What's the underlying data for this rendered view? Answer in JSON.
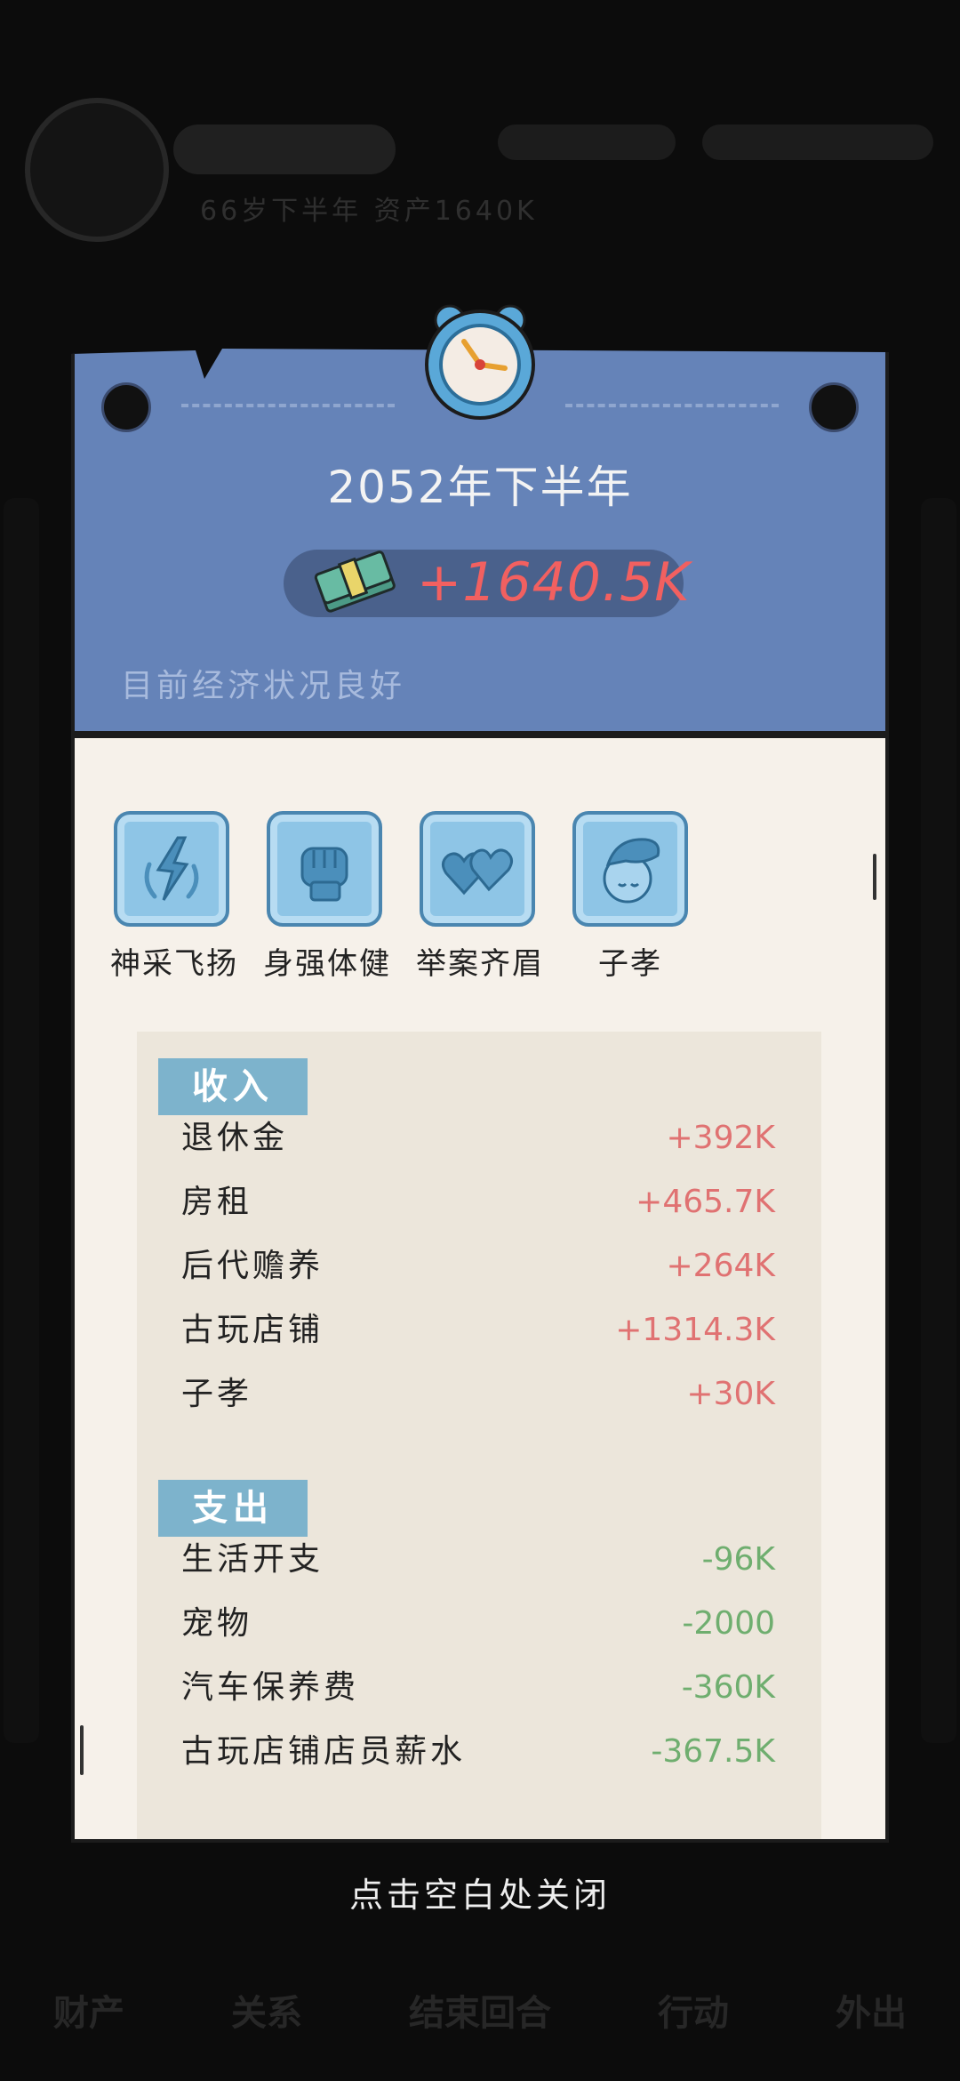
{
  "background": {
    "info_text": "66岁下半年 资产1640K",
    "nav": [
      "财产",
      "关系",
      "结束回合",
      "行动",
      "外出"
    ]
  },
  "dialog": {
    "period": "2052年下半年",
    "money_change": "+1640.5K",
    "economy_status": "目前经济状况良好",
    "traits": [
      {
        "label": "神采飞扬",
        "icon": "lightning-icon"
      },
      {
        "label": "身强体健",
        "icon": "fist-icon"
      },
      {
        "label": "举案齐眉",
        "icon": "hearts-icon"
      },
      {
        "label": "子孝",
        "icon": "head-pat-icon"
      }
    ],
    "income": {
      "title": "收入",
      "items": [
        {
          "label": "退休金",
          "amount": "+392K"
        },
        {
          "label": "房租",
          "amount": "+465.7K"
        },
        {
          "label": "后代赡养",
          "amount": "+264K"
        },
        {
          "label": "古玩店铺",
          "amount": "+1314.3K"
        },
        {
          "label": "子孝",
          "amount": "+30K"
        }
      ]
    },
    "expense": {
      "title": "支出",
      "items": [
        {
          "label": "生活开支",
          "amount": "-96K"
        },
        {
          "label": "宠物",
          "amount": "-2000"
        },
        {
          "label": "汽车保养费",
          "amount": "-360K"
        },
        {
          "label": "古玩店铺店员薪水",
          "amount": "-367.5K"
        }
      ]
    }
  },
  "close_hint": "点击空白处关闭",
  "colors": {
    "header": "#6583b8",
    "income_amount": "#e07272",
    "expense_amount": "#6fae6f",
    "tag": "#7db3cc",
    "money_value": "#f26060"
  }
}
